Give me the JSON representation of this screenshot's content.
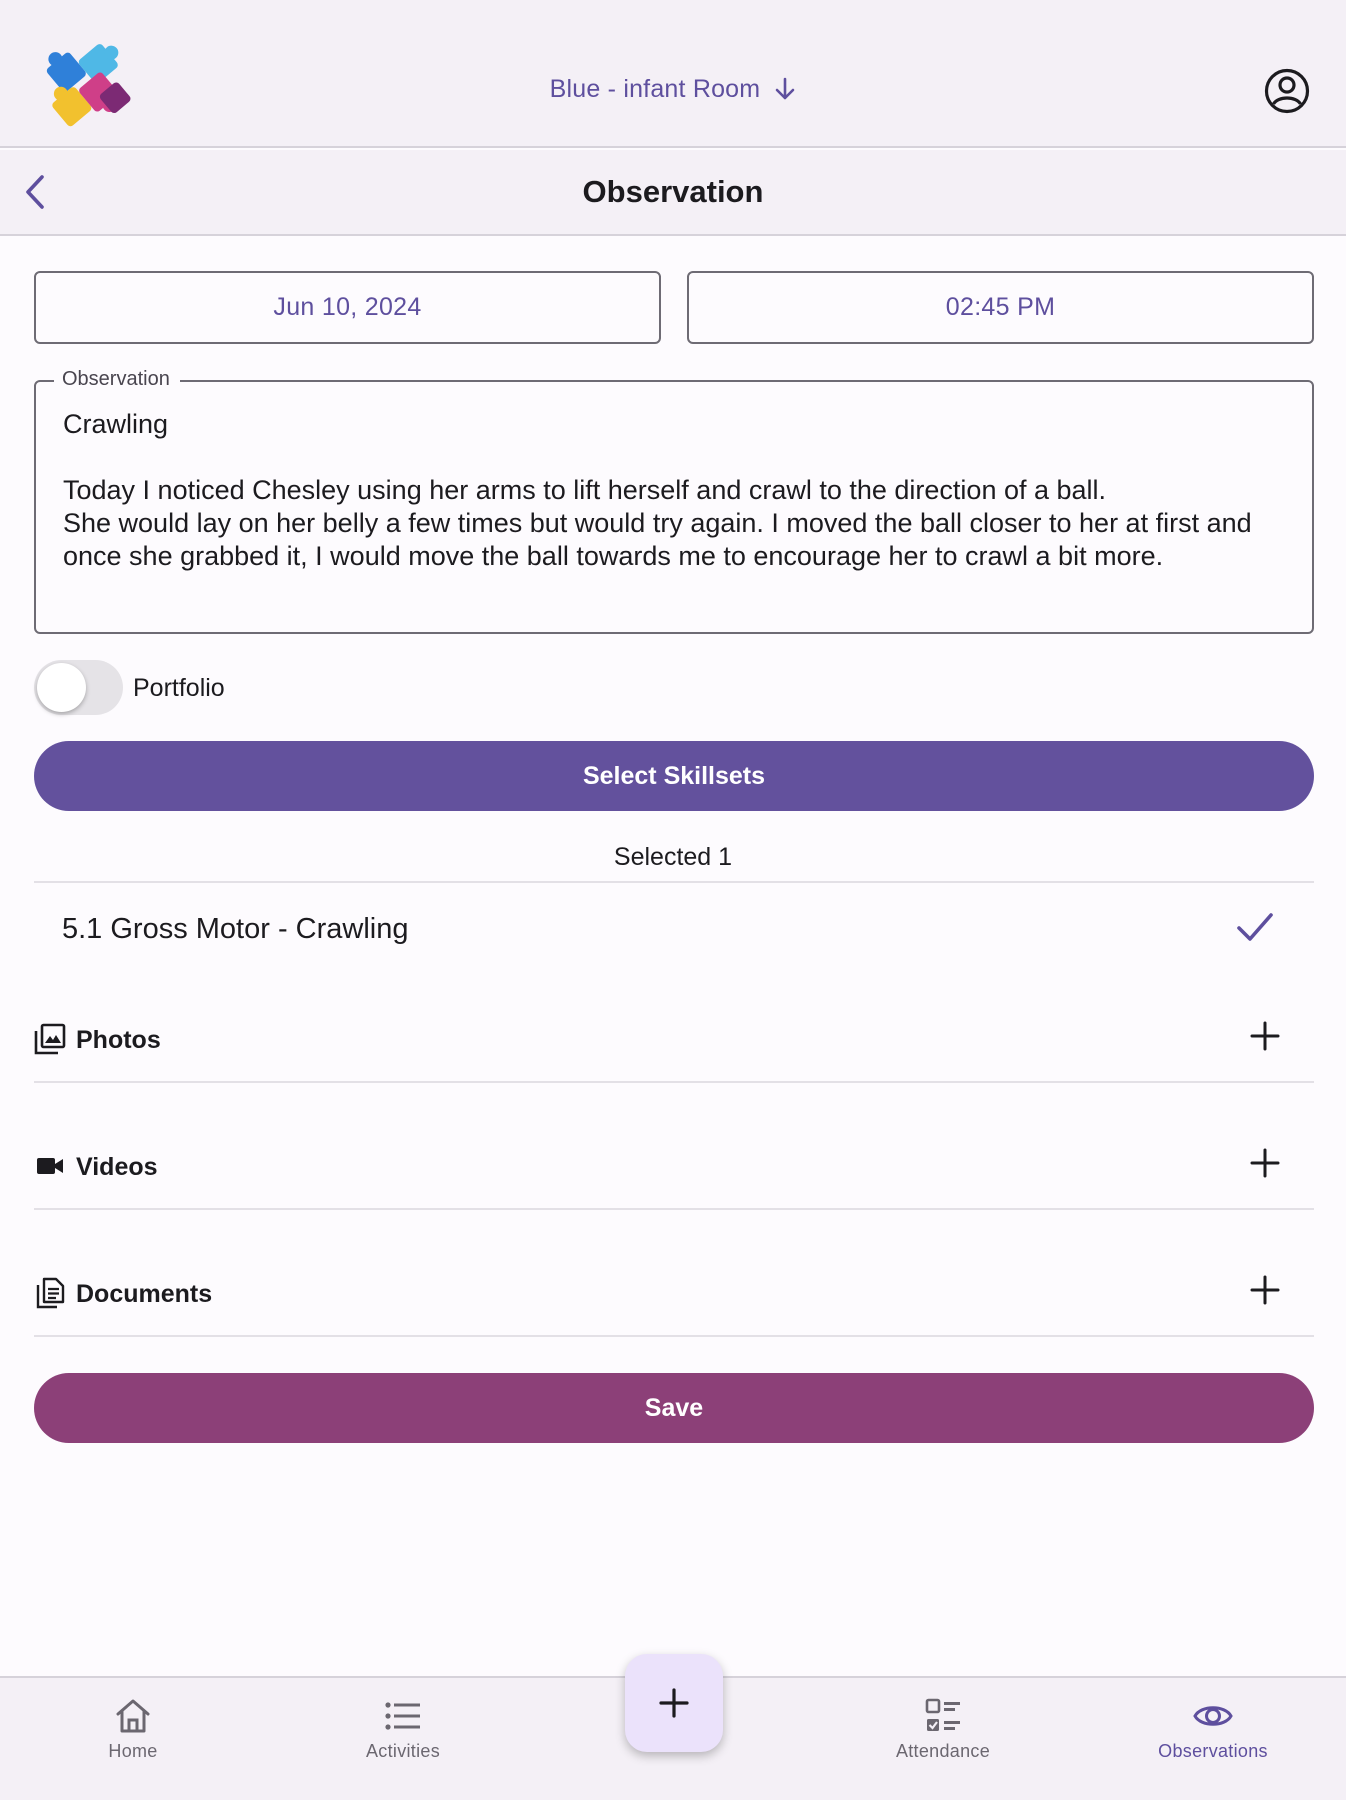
{
  "header": {
    "room_label": "Blue - infant Room",
    "room_arrow_icon": "arrow-down-icon",
    "profile_icon": "account-circle-icon",
    "logo_icon": "puzzle-logo"
  },
  "titlebar": {
    "title": "Observation",
    "back_icon": "chevron-left-icon"
  },
  "form": {
    "date": "Jun 10, 2024",
    "time": "02:45 PM",
    "observation_label": "Observation",
    "observation_text": "Crawling\n\nToday I noticed Chesley using her arms to lift herself and crawl to the direction of a ball.\nShe would lay on her belly a few times but would try again. I moved the ball closer to her at first and once she grabbed it, I would move the ball towards me to encourage her to crawl a bit more.",
    "portfolio_label": "Portfolio",
    "portfolio_on": false,
    "select_skillsets_label": "Select Skillsets",
    "selected_count_label": "Selected 1",
    "skills": [
      {
        "label": "5.1 Gross Motor - Crawling",
        "checked": true
      }
    ],
    "sections": [
      {
        "label": "Photos",
        "icon": "photo-library-icon"
      },
      {
        "label": "Videos",
        "icon": "videocam-icon"
      },
      {
        "label": "Documents",
        "icon": "document-icon"
      }
    ],
    "save_label": "Save"
  },
  "bottom_nav": {
    "items": [
      {
        "label": "Home",
        "icon": "home-icon",
        "active": false
      },
      {
        "label": "Activities",
        "icon": "list-icon",
        "active": false
      },
      {
        "label": "Attendance",
        "icon": "checklist-icon",
        "active": false
      },
      {
        "label": "Observations",
        "icon": "eye-icon",
        "active": true
      }
    ],
    "fab_icon": "plus-icon"
  },
  "colors": {
    "accent": "#63519d",
    "accent_text": "#5e4f9e",
    "save": "#8c4078",
    "bar_background": "#f4f0f6",
    "page_background": "#fdfbfe"
  }
}
